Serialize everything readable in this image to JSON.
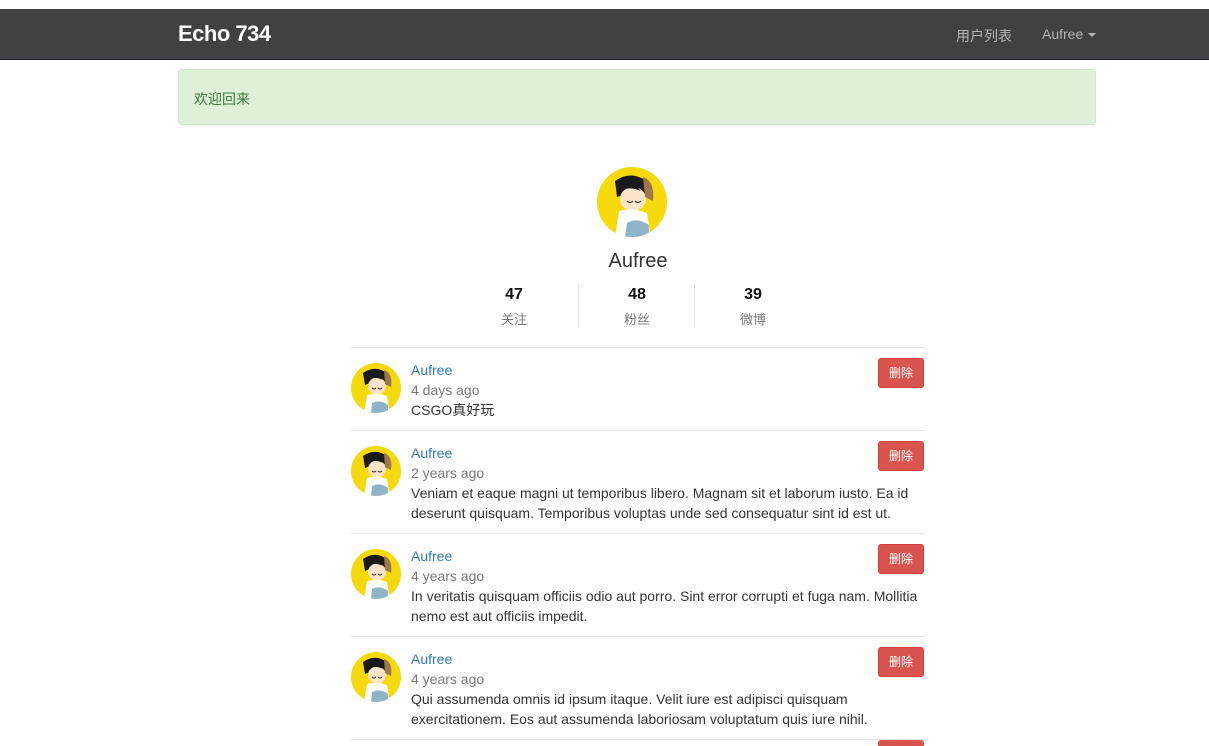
{
  "navbar": {
    "brand": "Echo 734",
    "users_link": "用户列表",
    "user_menu": "Aufree"
  },
  "alert": {
    "message": "欢迎回来"
  },
  "profile": {
    "name": "Aufree",
    "stats": [
      {
        "value": "47",
        "label": "关注"
      },
      {
        "value": "48",
        "label": "粉丝"
      },
      {
        "value": "39",
        "label": "微博"
      }
    ]
  },
  "feed": {
    "delete_label": "删除",
    "items": [
      {
        "author": "Aufree",
        "time": "4 days ago",
        "content": "CSGO真好玩"
      },
      {
        "author": "Aufree",
        "time": "2 years ago",
        "content": "Veniam et eaque magni ut temporibus libero. Magnam sit et laborum iusto. Ea id deserunt quisquam. Temporibus voluptas unde sed consequatur sint id est ut."
      },
      {
        "author": "Aufree",
        "time": "4 years ago",
        "content": "In veritatis quisquam officiis odio aut porro. Sint error corrupti et fuga nam. Mollitia nemo est aut officiis impedit."
      },
      {
        "author": "Aufree",
        "time": "4 years ago",
        "content": "Qui assumenda omnis id ipsum itaque. Velit iure est adipisci quisquam exercitationem. Eos aut assumenda laboriosam voluptatum quis iure nihil."
      }
    ]
  },
  "colors": {
    "navbar_bg": "#3f4144",
    "alert_bg": "#dff0d8",
    "alert_text": "#3c763d",
    "link": "#337ab7",
    "danger": "#d9534f",
    "avatar_bg": "#f5d90a"
  }
}
